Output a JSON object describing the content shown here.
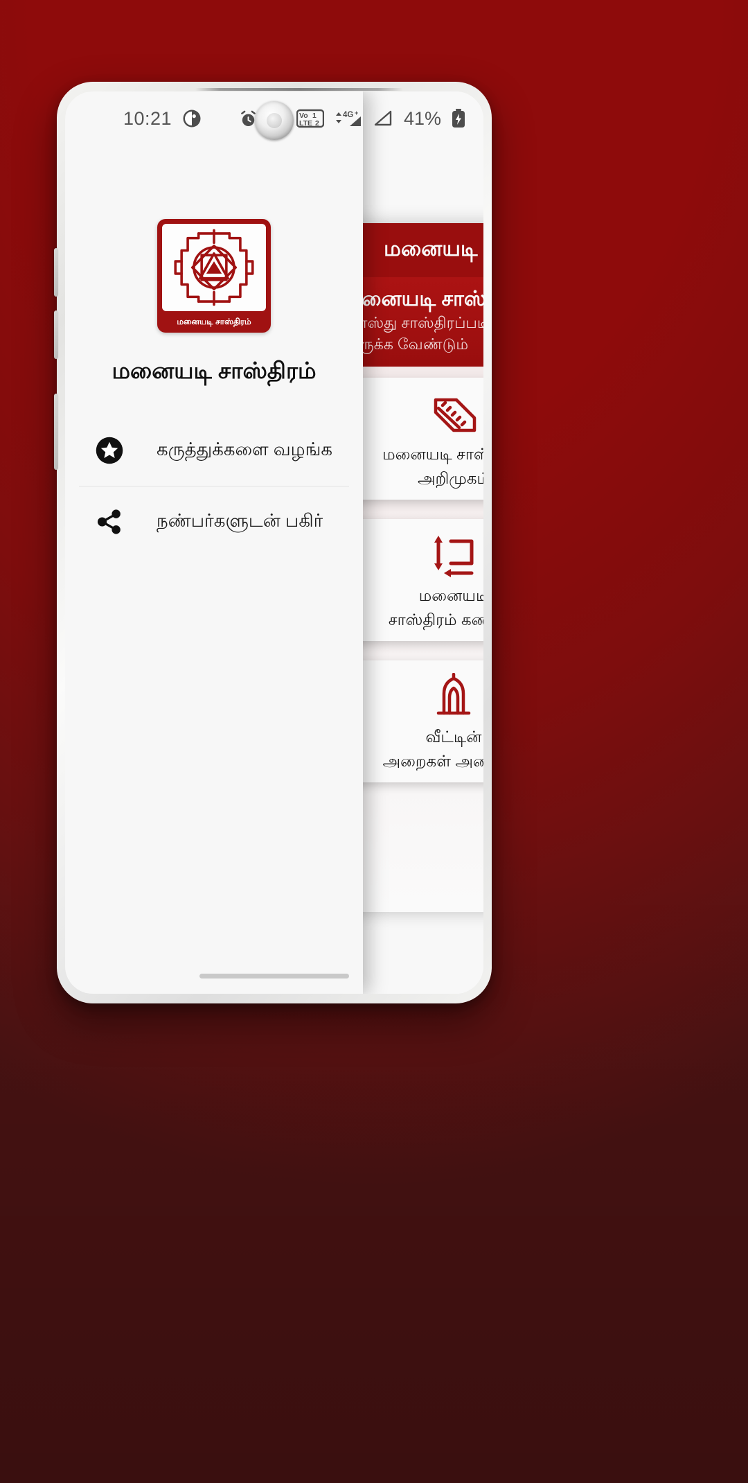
{
  "wallpaper": {
    "accent": "#8e0b0b",
    "bottom": "#4a1313"
  },
  "status_bar": {
    "time": "10:21",
    "left_icons": [
      "do-not-disturb-icon"
    ],
    "right_icons": [
      "alarm-icon",
      "hotspot-icon",
      "volte-dual-sim-icon",
      "mobile-data-4g-plus-icon",
      "signal-bars-icon"
    ],
    "network_label": "4G+",
    "volte_label_top": "Vo",
    "volte_label_bottom": "LTE",
    "sim_one": "1",
    "sim_two": "2",
    "battery_percent": "41%",
    "battery_state": "charging"
  },
  "drawer": {
    "logo": {
      "caption": "மனையடி சாஸ்திரம்",
      "icon": "sri-yantra-icon",
      "frame_color": "#a01212"
    },
    "title": "மனையடி சாஸ்திரம்",
    "items": [
      {
        "label": "கருத்துக்களை வழங்க",
        "icon": "star-rate-icon"
      },
      {
        "label": "நண்பர்களுடன் பகிர்",
        "icon": "share-icon"
      }
    ]
  },
  "app_panel": {
    "app_bar": {
      "back_icon": "arrow-left-icon",
      "title": "மனையடி சாஸ்திரம்",
      "background": "#9d0f0f"
    },
    "hero": {
      "title": "மனையடி சாஸ்திரம்",
      "subtitle_line1": "வாஸ்து சாஸ்திரப்படி வீடு எப்படி",
      "subtitle_line2": "இருக்க வேண்டும்"
    },
    "cards": [
      {
        "icon": "measuring-tape-icon",
        "label_line1": "மனையடி சாஸ்திரம்",
        "label_line2": "அறிமுகம்"
      },
      {
        "icon": "house-dimensions-icon",
        "label_line1": "மனையடி",
        "label_line2": "சாஸ்திரம் கணிப்பு"
      },
      {
        "icon": "temple-plan-icon",
        "label_line1": "வீட்டின்",
        "label_line2": "அறைகள் அமைப்பு"
      }
    ]
  },
  "gesture_bar": {
    "visible": true
  }
}
